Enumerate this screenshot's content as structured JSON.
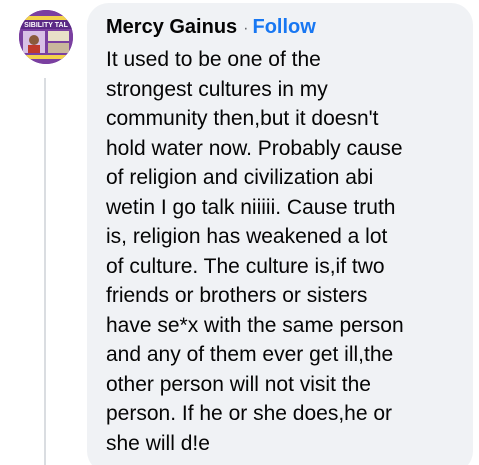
{
  "comment": {
    "author": "Mercy Gainus",
    "separator": "·",
    "follow_label": "Follow",
    "text": "It used to be one of the\nstrongest cultures in my\ncommunity then,but it doesn't\nhold water now. Probably cause\nof religion and civilization abi\nwetin I go talk niiiii. Cause truth\nis, religion has weakened a lot\nof culture. The culture is,if two\nfriends or brothers or sisters\nhave se*x with the same person\nand any of them ever get ill,the\nother person will not visit the\nperson. If he or she does,he or\nshe will d!e",
    "avatar_banner_text": "SIBILITY TAL"
  },
  "colors": {
    "bubble_bg": "#f0f2f5",
    "author": "#050505",
    "follow": "#1877f2",
    "avatar_bg": "#7a3fa0"
  }
}
